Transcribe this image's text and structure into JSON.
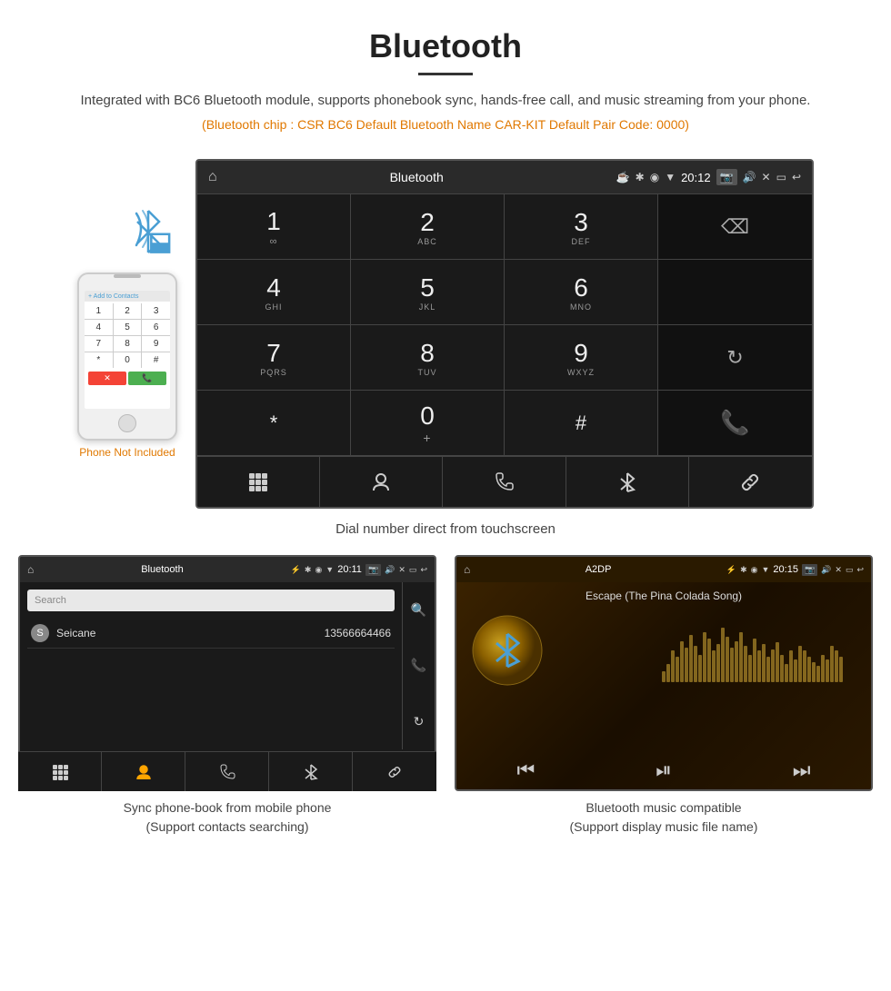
{
  "page": {
    "title": "Bluetooth",
    "description": "Integrated with BC6 Bluetooth module, supports phonebook sync, hands-free call, and music streaming from your phone.",
    "specs": "(Bluetooth chip : CSR BC6    Default Bluetooth Name CAR-KIT    Default Pair Code: 0000)"
  },
  "dialerScreen": {
    "appName": "Bluetooth",
    "time": "20:12",
    "keys": [
      {
        "num": "1",
        "sub": ""
      },
      {
        "num": "2",
        "sub": "ABC"
      },
      {
        "num": "3",
        "sub": "DEF"
      },
      {
        "num": "",
        "sub": ""
      },
      {
        "num": "4",
        "sub": "GHI"
      },
      {
        "num": "5",
        "sub": "JKL"
      },
      {
        "num": "6",
        "sub": "MNO"
      },
      {
        "num": "",
        "sub": ""
      },
      {
        "num": "7",
        "sub": "PQRS"
      },
      {
        "num": "8",
        "sub": "TUV"
      },
      {
        "num": "9",
        "sub": "WXYZ"
      },
      {
        "num": "",
        "sub": ""
      },
      {
        "num": "*",
        "sub": ""
      },
      {
        "num": "0",
        "sub": "+"
      },
      {
        "num": "#",
        "sub": ""
      },
      {
        "num": "",
        "sub": ""
      },
      {
        "num": "",
        "sub": ""
      },
      {
        "num": "",
        "sub": ""
      },
      {
        "num": "",
        "sub": ""
      },
      {
        "num": "",
        "sub": ""
      }
    ],
    "caption": "Dial number direct from touchscreen"
  },
  "phonebookScreen": {
    "appName": "Bluetooth",
    "time": "20:11",
    "searchPlaceholder": "Search",
    "contacts": [
      {
        "letter": "S",
        "name": "Seicane",
        "phone": "13566664466"
      }
    ],
    "caption": "Sync phone-book from mobile phone\n(Support contacts searching)"
  },
  "musicScreen": {
    "appName": "A2DP",
    "time": "20:15",
    "songTitle": "Escape (The Pina Colada Song)",
    "caption": "Bluetooth music compatible\n(Support display music file name)"
  },
  "phoneNotIncluded": "Phone Not Included",
  "musicBarHeights": [
    12,
    20,
    35,
    28,
    45,
    38,
    52,
    40,
    30,
    55,
    48,
    35,
    42,
    60,
    50,
    38,
    45,
    55,
    40,
    30,
    48,
    35,
    42,
    28,
    36,
    44,
    30,
    20,
    35,
    25,
    40,
    35,
    28,
    22,
    18,
    30,
    25,
    40,
    35,
    28
  ]
}
